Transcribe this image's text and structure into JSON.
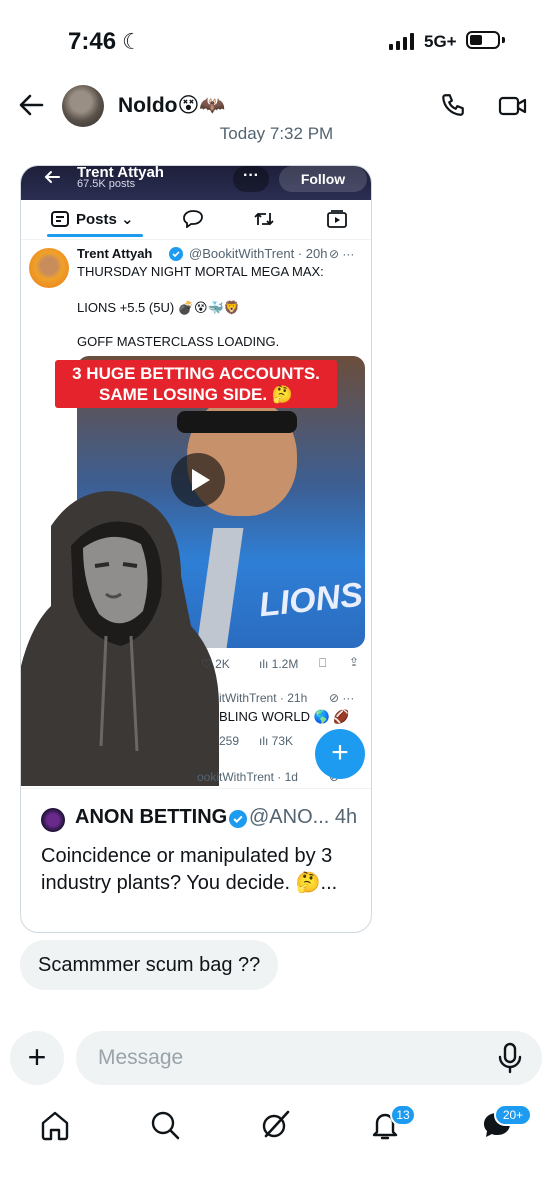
{
  "status": {
    "time": "7:46",
    "network": "5G+"
  },
  "chat": {
    "contact_name": "Noldo",
    "contact_emoji": "😵🦇",
    "timestamp": "Today 7:32 PM"
  },
  "shared_post": {
    "profile_name": "Trent Attyah",
    "profile_posts": "67.5K posts",
    "follow_label": "Follow",
    "tab_label": "Posts",
    "author": "Trent Attyah",
    "handle_time": "@BookitWithTrent · 20h",
    "line1": "THURSDAY NIGHT MORTAL MEGA MAX:",
    "line2": "LIONS +5.5 (5U) 💣😵🐳🦁",
    "line3": "GOFF MASTERCLASS LOADING.",
    "banner_line1": "3 HUGE BETTING ACCOUNTS.",
    "banner_line2": "SAME LOSING SIDE. 🤔",
    "jersey_text": "LIONS",
    "likes": "2K",
    "views": "1.2M",
    "reply2_handle": "itWithTrent · 21h",
    "reply2_text": "BLING WORLD 🌎 🏈",
    "reply2_likes": "259",
    "reply2_views": "73K",
    "reply3_handle": "ookitWithTrent · 1d",
    "quote_author": "ANON BETTING",
    "quote_handle": "@ANO... 4h",
    "quote_text": "Coincidence or manipulated by 3 industry plants? You decide. 🤔..."
  },
  "message_bubble": "Scammmer scum bag ??",
  "composer": {
    "placeholder": "Message"
  },
  "nav": {
    "notifications_badge": "13",
    "messages_badge": "20+"
  },
  "colors": {
    "accent": "#1d9bf0",
    "banner_red": "#e5232c",
    "bubble_bg": "#eff3f4"
  }
}
